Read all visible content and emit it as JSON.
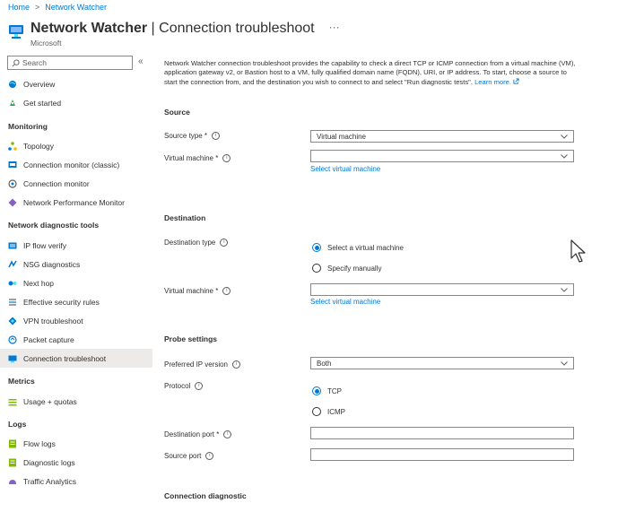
{
  "breadcrumb": {
    "home": "Home",
    "separator": ">",
    "current": "Network Watcher"
  },
  "header": {
    "title_strong": "Network Watcher",
    "title_rest": " | Connection troubleshoot",
    "subtitle": "Microsoft",
    "more": "···"
  },
  "sidebar": {
    "search_placeholder": "Search",
    "collapse": "«",
    "top_items": [
      {
        "label": "Overview"
      },
      {
        "label": "Get started"
      }
    ],
    "monitoring_header": "Monitoring",
    "monitoring_items": [
      {
        "label": "Topology"
      },
      {
        "label": "Connection monitor (classic)"
      },
      {
        "label": "Connection monitor"
      },
      {
        "label": "Network Performance Monitor"
      }
    ],
    "diag_header": "Network diagnostic tools",
    "diag_items": [
      {
        "label": "IP flow verify"
      },
      {
        "label": "NSG diagnostics"
      },
      {
        "label": "Next hop"
      },
      {
        "label": "Effective security rules"
      },
      {
        "label": "VPN troubleshoot"
      },
      {
        "label": "Packet capture"
      },
      {
        "label": "Connection troubleshoot"
      }
    ],
    "metrics_header": "Metrics",
    "metrics_items": [
      {
        "label": "Usage + quotas"
      }
    ],
    "logs_header": "Logs",
    "logs_items": [
      {
        "label": "Flow logs"
      },
      {
        "label": "Diagnostic logs"
      },
      {
        "label": "Traffic Analytics"
      }
    ]
  },
  "main": {
    "intro": "Network Watcher connection troubleshoot provides the capability to check a direct TCP or ICMP connection from a virtual machine (VM), application gateway v2, or Bastion host to a VM, fully qualified domain name (FQDN), URI, or IP address. To start, choose a source to start the connection from, and the destination you wish to connect to and select \"Run diagnostic tests\".",
    "learn_more": "Learn more.",
    "source": {
      "header": "Source",
      "type_label": "Source type *",
      "type_value": "Virtual machine",
      "vm_label": "Virtual machine *",
      "vm_value": "",
      "select_link": "Select virtual machine"
    },
    "destination": {
      "header": "Destination",
      "type_label": "Destination type",
      "option_select": "Select a virtual machine",
      "option_manual": "Specify manually",
      "vm_label": "Virtual machine *",
      "vm_value": "",
      "select_link": "Select virtual machine"
    },
    "probe": {
      "header": "Probe settings",
      "ip_label": "Preferred IP version",
      "ip_value": "Both",
      "protocol_label": "Protocol",
      "protocol_tcp": "TCP",
      "protocol_icmp": "ICMP",
      "dest_port_label": "Destination port *",
      "dest_port_value": "",
      "src_port_label": "Source port",
      "src_port_value": ""
    },
    "diag_header": "Connection diagnostic"
  },
  "colors": {
    "accent": "#0078d4",
    "active_bg": "#edebe9",
    "border": "#8a8886"
  }
}
